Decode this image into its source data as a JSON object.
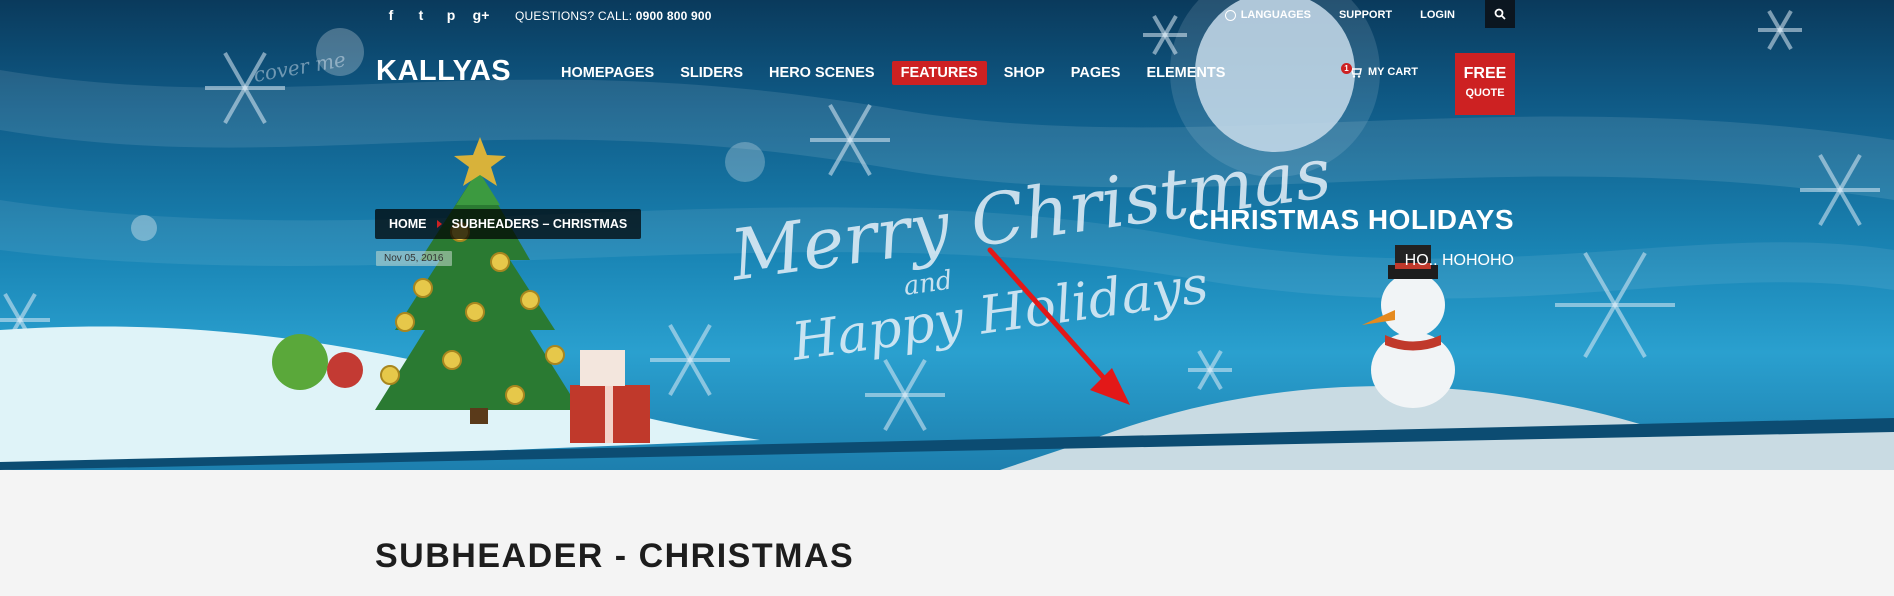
{
  "topbar": {
    "social": [
      {
        "name": "facebook-icon",
        "glyph": "f"
      },
      {
        "name": "twitter-icon",
        "glyph": "t"
      },
      {
        "name": "pinterest-icon",
        "glyph": "p"
      },
      {
        "name": "googleplus-icon",
        "glyph": "g+"
      }
    ],
    "questions_label": "QUESTIONS? CALL:",
    "phone": "0900 800 900",
    "languages": "LANGUAGES",
    "support": "SUPPORT",
    "login": "LOGIN"
  },
  "header": {
    "logo": "KALLYAS",
    "nav": [
      {
        "label": "HOMEPAGES",
        "active": false
      },
      {
        "label": "SLIDERS",
        "active": false
      },
      {
        "label": "HERO SCENES",
        "active": false
      },
      {
        "label": "FEATURES",
        "active": true
      },
      {
        "label": "SHOP",
        "active": false
      },
      {
        "label": "PAGES",
        "active": false
      },
      {
        "label": "ELEMENTS",
        "active": false
      }
    ],
    "cart_count": "1",
    "cart_label": "MY CART",
    "free_label": "FREE",
    "quote_label": "QUOTE"
  },
  "hero": {
    "breadcrumb_home": "HOME",
    "breadcrumb_current": "SUBHEADERS – CHRISTMAS",
    "date": "Nov 05, 2016",
    "title": "CHRISTMAS HOLIDAYS",
    "subtitle": "HO.. HOHOHO",
    "artwork_text_1": "Merry Christmas",
    "artwork_text_2": "and",
    "artwork_text_3": "Happy Holidays",
    "artwork_text_4": "cover me"
  },
  "page": {
    "heading": "SUBHEADER - CHRISTMAS"
  },
  "colors": {
    "accent": "#cd2122",
    "hero_dark": "#0a3a5c",
    "hero_light": "#2aa0cf",
    "page_bg": "#f4f4f4"
  }
}
